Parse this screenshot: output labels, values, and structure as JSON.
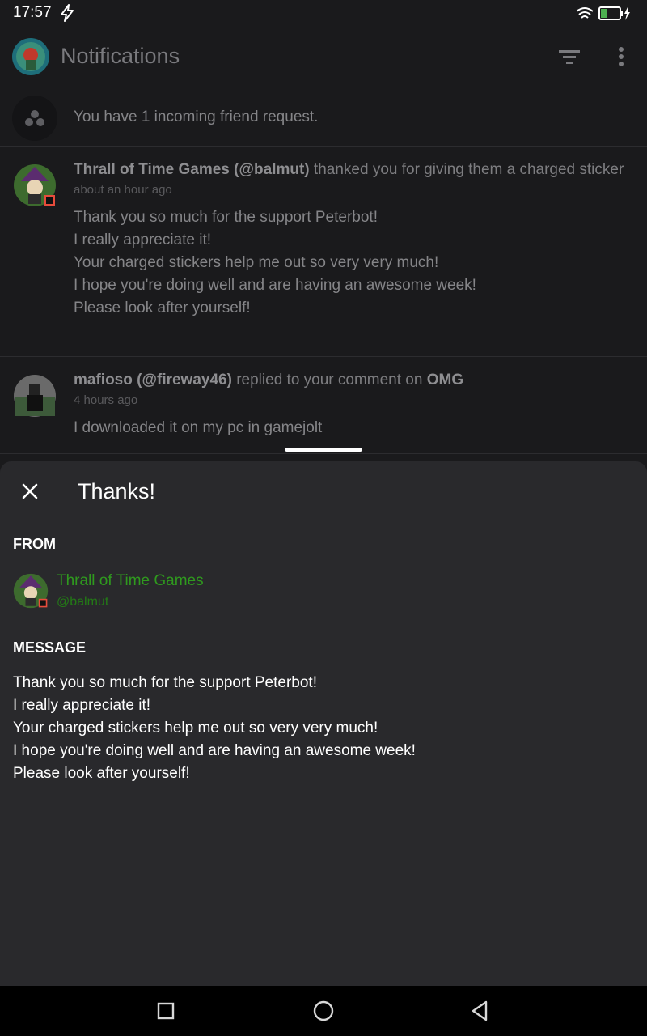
{
  "status_bar": {
    "time": "17:57"
  },
  "header": {
    "title": "Notifications"
  },
  "friend_request": {
    "text": "You have 1 incoming friend request."
  },
  "notifications": [
    {
      "user_name": "Thrall of Time Games",
      "user_handle": "(@balmut)",
      "action": "thanked you for giving them a charged sticker",
      "time": "about an hour ago",
      "message_lines": [
        "Thank you so much for the support Peterbot!",
        "I really appreciate it!",
        "Your charged stickers help me out so very very much!",
        "I hope you're doing well and are having an awesome week!",
        "Please look after yourself!"
      ]
    },
    {
      "user_name": "mafioso",
      "user_handle": "(@fireway46)",
      "action": "replied to your comment on",
      "target": "OMG",
      "time": "4 hours ago",
      "message_lines": [
        "I downloaded it on my pc in gamejolt"
      ]
    }
  ],
  "sheet": {
    "title": "Thanks!",
    "from_label": "FROM",
    "from_name": "Thrall of Time Games",
    "from_handle": "@balmut",
    "message_label": "MESSAGE",
    "message_lines": [
      "Thank you so much for the support Peterbot!",
      "I really appreciate it!",
      "Your charged stickers help me out so very very much!",
      "I hope you're doing well and are having an awesome week!",
      "Please look after yourself!"
    ]
  },
  "colors": {
    "background": "#1a1a1c",
    "sheet": "#29292c",
    "accent_green": "#2f9a1e"
  },
  "icons": {
    "status": [
      "lightning-icon",
      "wifi-icon",
      "battery-charging-icon"
    ],
    "header": [
      "user-avatar",
      "filter-icon",
      "more-vert-icon"
    ],
    "nav": [
      "recents-square-icon",
      "home-circle-icon",
      "back-triangle-icon"
    ]
  }
}
